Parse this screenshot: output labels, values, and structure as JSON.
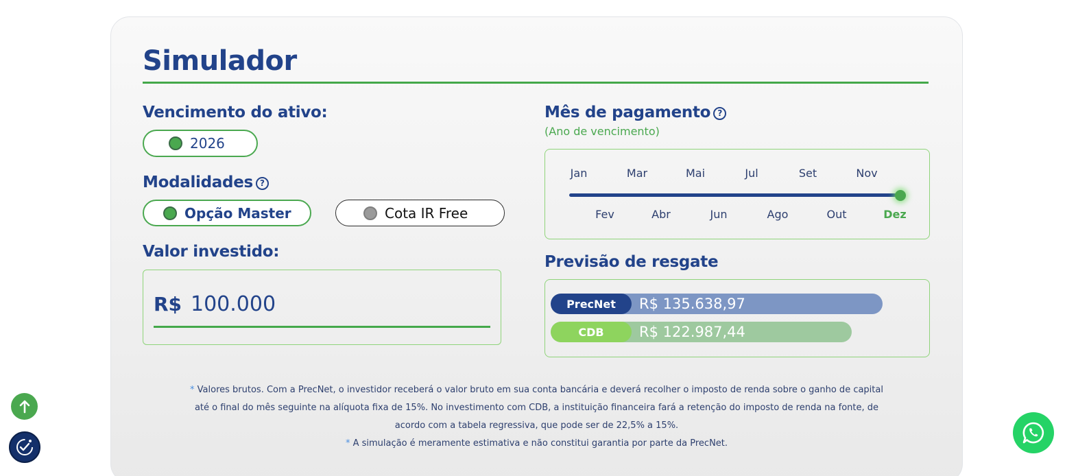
{
  "title": "Simulador",
  "maturity": {
    "heading": "Vencimento do ativo:",
    "option": "2026"
  },
  "modalities": {
    "heading": "Modalidades",
    "options": [
      "Opção Master",
      "Cota IR Free"
    ],
    "selected": "Opção Master"
  },
  "invested": {
    "heading": "Valor investido:",
    "currency": "R$",
    "value": "100.000"
  },
  "payment_month": {
    "heading": "Mês de pagamento",
    "subtitle": "(Ano de vencimento)",
    "top_months": [
      "Jan",
      "Mar",
      "Mai",
      "Jul",
      "Set",
      "Nov"
    ],
    "bottom_months": [
      "Fev",
      "Abr",
      "Jun",
      "Ago",
      "Out",
      "Dez"
    ],
    "selected": "Dez",
    "slider_fraction": 1.0
  },
  "forecast": {
    "heading": "Previsão de resgate",
    "items": [
      {
        "label": "PrecNet",
        "value": "R$ 135.638,97"
      },
      {
        "label": "CDB",
        "value": "R$ 122.987,44"
      }
    ]
  },
  "footnotes": {
    "star": "*",
    "line1": "Valores brutos. Com a PrecNet, o investidor receberá o valor bruto em sua conta bancária e deverá recolher o imposto de renda sobre o ganho de capital até o final do mês seguinte na alíquota fixa de 15%. No investimento com CDB, a instituição financeira fará a retenção do imposto de renda na fonte, de acordo com a tabela regressiva, que pode ser de 22,5% a 15%.",
    "line2": "A simulação é meramente estimativa e não constitui garantia por parte da PrecNet."
  },
  "colors": {
    "primary": "#22438a",
    "accent": "#4aa84f",
    "precnet_bar": "#7d96c4",
    "cdb_bar": "#9ec99f",
    "whatsapp": "#25d366"
  },
  "icons": {
    "scroll_top": "arrow-up-icon",
    "accessibility": "accessibility-check-icon",
    "chat": "whatsapp-icon"
  }
}
